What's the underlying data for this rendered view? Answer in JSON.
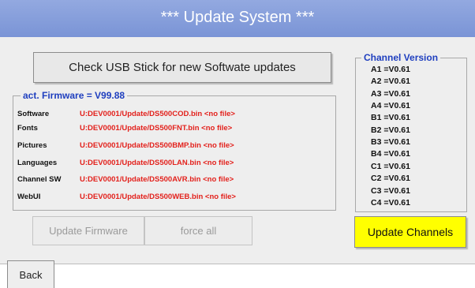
{
  "title": "***   Update System   ***",
  "check_usb_label": "Check USB Stick for new Softwate updates",
  "firmware": {
    "legend": "act. Firmware = V99.88",
    "rows": [
      {
        "label": "Software",
        "path": "U:DEV0001/Update/DS500COD.bin <no file>"
      },
      {
        "label": "Fonts",
        "path": "U:DEV0001/Update/DS500FNT.bin <no file>"
      },
      {
        "label": "Pictures",
        "path": "U:DEV0001/Update/DS500BMP.bin <no file>"
      },
      {
        "label": "Languages",
        "path": "U:DEV0001/Update/DS500LAN.bin <no file>"
      },
      {
        "label": "Channel SW",
        "path": "U:DEV0001/Update/DS500AVR.bin <no file>"
      },
      {
        "label": "WebUI",
        "path": "U:DEV0001/Update/DS500WEB.bin <no file>"
      }
    ]
  },
  "update_firmware_label": "Update Firmware",
  "force_all_label": "force all",
  "channels": {
    "legend": "Channel Version",
    "rows": [
      "A1 =V0.61",
      "A2 =V0.61",
      "A3 =V0.61",
      "A4 =V0.61",
      "B1 =V0.61",
      "B2 =V0.61",
      "B3 =V0.61",
      "B4 =V0.61",
      "C1 =V0.61",
      "C2 =V0.61",
      "C3 =V0.61",
      "C4 =V0.61"
    ]
  },
  "update_channels_label": "Update Channels",
  "back_label": "Back",
  "colors": {
    "title_bar": "#7a94d6",
    "legend_text": "#1f3fbf",
    "path_text": "#e3211c",
    "highlight_button": "#ffff00"
  }
}
